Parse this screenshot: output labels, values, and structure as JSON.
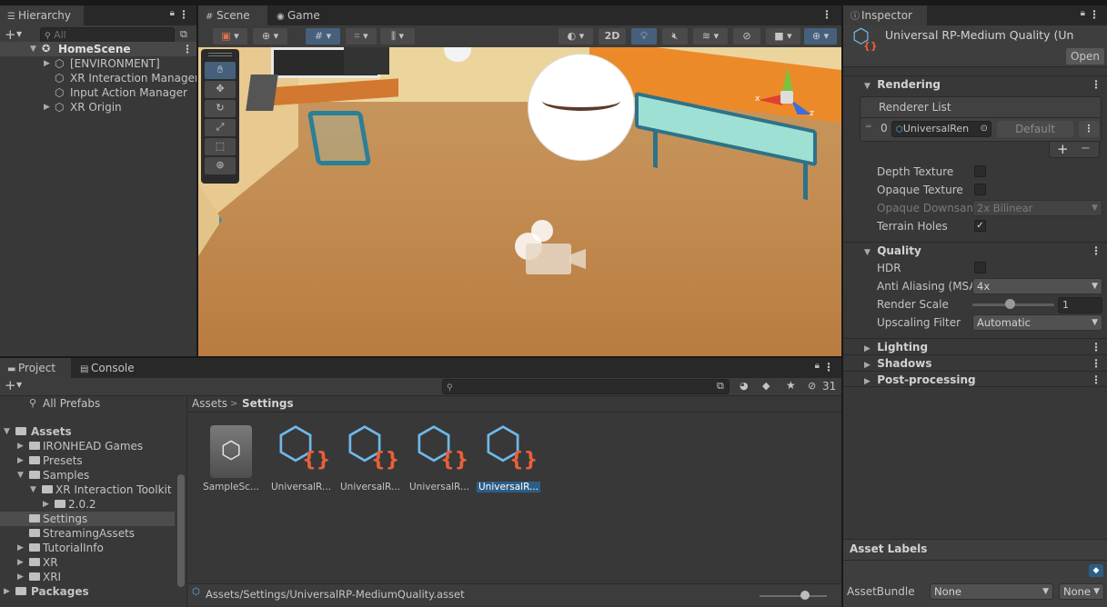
{
  "hierarchy": {
    "tab": "Hierarchy",
    "search_placeholder": "All",
    "scene": "HomeScene",
    "items": [
      "[ENVIRONMENT]",
      "XR Interaction Manager",
      "Input Action Manager",
      "XR Origin"
    ]
  },
  "scene_view": {
    "tabs": [
      "Scene",
      "Game"
    ],
    "toolbar_2d": "2D"
  },
  "inspector": {
    "tab": "Inspector",
    "asset_title": "Universal RP-Medium Quality (Un",
    "open_button": "Open",
    "sections": {
      "rendering": "Rendering",
      "quality": "Quality",
      "lighting": "Lighting",
      "shadows": "Shadows",
      "post_processing": "Post-processing"
    },
    "renderer_list": {
      "label": "Renderer List",
      "index": "0",
      "renderer": "UniversalRen",
      "default_button": "Default",
      "add": "+",
      "remove": "−"
    },
    "rendering_props": {
      "depth_texture": "Depth Texture",
      "opaque_texture": "Opaque Texture",
      "opaque_downsampling": "Opaque Downsam",
      "opaque_downsampling_value": "2x Bilinear",
      "terrain_holes": "Terrain Holes",
      "depth_texture_checked": false,
      "opaque_texture_checked": false,
      "terrain_holes_checked": true
    },
    "quality_props": {
      "hdr": "HDR",
      "hdr_checked": false,
      "anti_aliasing": "Anti Aliasing (MSA",
      "anti_aliasing_value": "4x",
      "render_scale": "Render Scale",
      "render_scale_value": "1",
      "render_scale_fraction": 0.47,
      "upscaling_filter": "Upscaling Filter",
      "upscaling_filter_value": "Automatic"
    },
    "asset_labels": {
      "title": "Asset Labels",
      "asset_bundle_label": "AssetBundle",
      "bundle_value": "None",
      "variant_value": "None"
    }
  },
  "project": {
    "tabs": [
      "Project",
      "Console"
    ],
    "hidden_count": "31",
    "breadcrumb": [
      "Assets",
      "Settings"
    ],
    "favorites": "All Prefabs",
    "tree": {
      "assets": "Assets",
      "items": [
        "IRONHEAD Games",
        "Presets",
        "Samples",
        "XR Interaction Toolkit",
        "2.0.2",
        "Settings",
        "StreamingAssets",
        "TutorialInfo",
        "XR",
        "XRI"
      ],
      "packages": "Packages"
    },
    "assets": [
      "SampleSc...",
      "UniversalR...",
      "UniversalR...",
      "UniversalR...",
      "UniversalR..."
    ],
    "path": "Assets/Settings/UniversalRP-MediumQuality.asset"
  }
}
